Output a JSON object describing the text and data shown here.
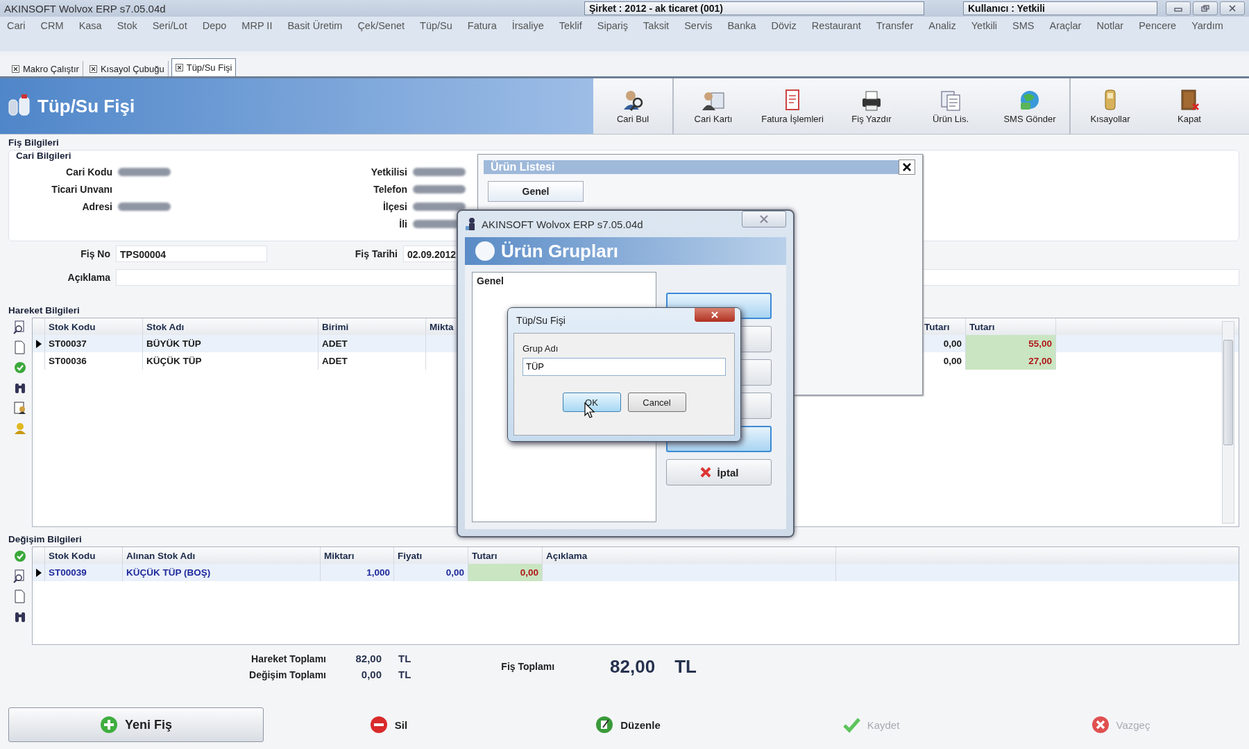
{
  "window": {
    "title": "AKINSOFT Wolvox ERP s7.05.04d",
    "company": "Şirket : 2012 - ak ticaret (001)",
    "user": "Kullanıcı : Yetkili"
  },
  "menu": [
    "Cari",
    "CRM",
    "Kasa",
    "Stok",
    "Seri/Lot",
    "Depo",
    "MRP II",
    "Basit Üretim",
    "Çek/Senet",
    "Tüp/Su",
    "Fatura",
    "İrsaliye",
    "Teklif",
    "Sipariş",
    "Taksit",
    "Servis",
    "Banka",
    "Döviz",
    "Restaurant",
    "Transfer",
    "Analiz",
    "Yetkili",
    "SMS",
    "Araçlar",
    "Notlar",
    "Pencere",
    "Yardım"
  ],
  "tabs": [
    {
      "label": "Makro Çalıştır",
      "selected": false
    },
    {
      "label": "Kısayol Çubuğu",
      "selected": false
    },
    {
      "label": "Tüp/Su Fişi",
      "selected": true
    }
  ],
  "header": {
    "title": "Tüp/Su Fişi"
  },
  "toolbar": [
    {
      "label": "Cari Bul",
      "kind": "find"
    },
    {
      "label": "Cari Kartı",
      "kind": "card"
    },
    {
      "label": "Fatura İşlemleri",
      "kind": "invoice"
    },
    {
      "label": "Fiş Yazdır",
      "kind": "print"
    },
    {
      "label": "Ürün Lis.",
      "kind": "list"
    },
    {
      "label": "SMS Gönder",
      "kind": "sms"
    },
    {
      "label": "Kısayollar",
      "kind": "shortcut"
    },
    {
      "label": "Kapat",
      "kind": "close"
    }
  ],
  "receipt_info": {
    "title": "Fiş Bilgileri",
    "account": {
      "title": "Cari Bilgileri",
      "left_fields": [
        {
          "label": "Cari Kodu",
          "obscured": true
        },
        {
          "label": "Ticari Unvanı",
          "obscured": false
        },
        {
          "label": "Adresi",
          "obscured": true
        }
      ],
      "right_fields": [
        {
          "label": "Yetkilisi",
          "obscured": true
        },
        {
          "label": "Telefon",
          "obscured": true
        },
        {
          "label": "İlçesi",
          "obscured": true
        },
        {
          "label": "İli",
          "obscured": true
        }
      ]
    },
    "receipt_no": {
      "label": "Fiş No",
      "value": "TPS00004"
    },
    "date": {
      "label": "Fiş Tarihi",
      "value": "02.09.2012"
    },
    "description": {
      "label": "Açıklama"
    }
  },
  "movements": {
    "title": "Hareket Bilgileri",
    "columns": [
      {
        "label": "Stok Kodu",
        "highlighted": false
      },
      {
        "label": "Stok Adı",
        "highlighted": false
      },
      {
        "label": "Birimi",
        "highlighted": false
      },
      {
        "label": "Mikta",
        "highlighted": false
      },
      {
        "label": "Tutarı",
        "highlighted": false
      },
      {
        "label": "Tutarı",
        "highlighted": true
      }
    ],
    "rows": [
      {
        "selected": true,
        "cells": [
          "ST00037",
          "BÜYÜK TÜP",
          "ADET",
          null,
          "0,00",
          "55,00"
        ]
      },
      {
        "selected": false,
        "cells": [
          "ST00036",
          "KÜÇÜK TÜP",
          "ADET",
          null,
          "0,00",
          "27,00"
        ]
      }
    ]
  },
  "exchange": {
    "title": "Değişim Bilgileri",
    "columns": [
      {
        "label": "Stok Kodu",
        "highlighted": false
      },
      {
        "label": "Alınan Stok Adı",
        "highlighted": false
      },
      {
        "label": "Miktarı",
        "highlighted": false
      },
      {
        "label": "Fiyatı",
        "highlighted": false
      },
      {
        "label": "Tutarı",
        "highlighted": true
      },
      {
        "label": "Açıklama",
        "highlighted": false
      }
    ],
    "rows": [
      {
        "selected": true,
        "cells": [
          "ST00039",
          "KÜÇÜK TÜP (BOŞ)",
          "1,000",
          "0,00",
          "0,00",
          null
        ]
      }
    ]
  },
  "totals": {
    "movement": {
      "label": "Hareket Toplamı",
      "value": "82,00",
      "currency": "TL"
    },
    "exchange": {
      "label": "Değişim Toplamı",
      "value": "0,00",
      "currency": "TL"
    },
    "receipt": {
      "label": "Fiş Toplamı",
      "value": "82,00",
      "currency": "TL"
    }
  },
  "actions": [
    {
      "label": "Yeni Fiş",
      "kind": "new",
      "disabled": false
    },
    {
      "label": "Sil",
      "kind": "delete",
      "disabled": false
    },
    {
      "label": "Düzenle",
      "kind": "edit",
      "disabled": false
    },
    {
      "label": "Kaydet",
      "kind": "save",
      "disabled": true
    },
    {
      "label": "Vazgeç",
      "kind": "cancel",
      "disabled": true
    }
  ],
  "product_list": {
    "title": "Ürün Listesi",
    "tabs": [
      {
        "label": "Genel",
        "selected": true
      }
    ]
  },
  "product_groups": {
    "window_title": "AKINSOFT Wolvox ERP s7.05.04d",
    "title": "Ürün Grupları",
    "items": [
      {
        "label": "Genel",
        "selected": false
      }
    ],
    "buttons": [
      {
        "kind": "blank",
        "focused": true
      },
      {
        "kind": "blank",
        "focused": false
      },
      {
        "kind": "blank",
        "focused": false
      },
      {
        "kind": "blank",
        "focused": false
      },
      {
        "kind": "blank",
        "focused": true
      },
      {
        "kind": "cancel",
        "label": "İptal",
        "focused": false
      }
    ]
  },
  "input_dialog": {
    "title": "Tüp/Su Fişi",
    "field": {
      "label": "Grup Adı",
      "value": "TÜP"
    },
    "buttons": [
      {
        "label": "OK",
        "focused": true
      },
      {
        "label": "Cancel",
        "focused": false
      }
    ]
  }
}
